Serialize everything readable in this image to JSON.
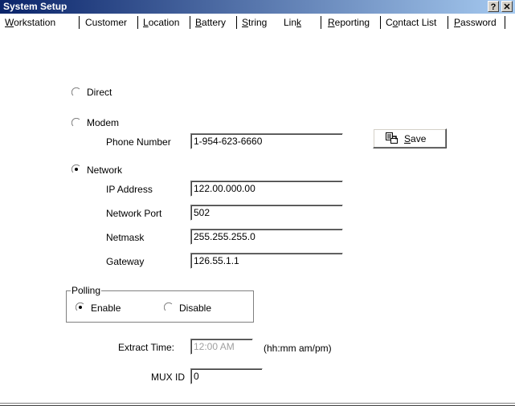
{
  "window": {
    "title": "System Setup",
    "help_btn": "?",
    "close_btn": "✕"
  },
  "tabs": [
    {
      "pre": "",
      "u": "W",
      "post": "orkstation"
    },
    {
      "pre": "Customer",
      "u": "",
      "post": ""
    },
    {
      "pre": "",
      "u": "L",
      "post": "ocation"
    },
    {
      "pre": "",
      "u": "B",
      "post": "attery"
    },
    {
      "pre": "",
      "u": "S",
      "post": "tring"
    },
    {
      "pre": "Lin",
      "u": "k",
      "post": ""
    },
    {
      "pre": "",
      "u": "R",
      "post": "eporting"
    },
    {
      "pre": "C",
      "u": "o",
      "post": "ntact List"
    },
    {
      "pre": "",
      "u": "P",
      "post": "assword"
    }
  ],
  "connection": {
    "direct_label": "Direct",
    "modem_label": "Modem",
    "network_label": "Network",
    "selected": "Network"
  },
  "modem": {
    "phone_label": "Phone Number",
    "phone_value": "1-954-623-6660"
  },
  "network": {
    "ip_label": "IP Address",
    "ip_value": "122.00.000.00",
    "port_label": "Network Port",
    "port_value": "502",
    "netmask_label": "Netmask",
    "netmask_value": "255.255.255.0",
    "gateway_label": "Gateway",
    "gateway_value": "126.55.1.1"
  },
  "save": {
    "pre": "",
    "u": "S",
    "post": "ave",
    "icon": "save-icon"
  },
  "polling": {
    "group_label": "Polling",
    "enable_label": "Enable",
    "disable_label": "Disable",
    "selected": "Enable"
  },
  "extract": {
    "label": "Extract Time:",
    "value": "12:00 AM",
    "hint": "(hh:mm  am/pm)"
  },
  "mux": {
    "label": "MUX ID",
    "value": "0"
  }
}
